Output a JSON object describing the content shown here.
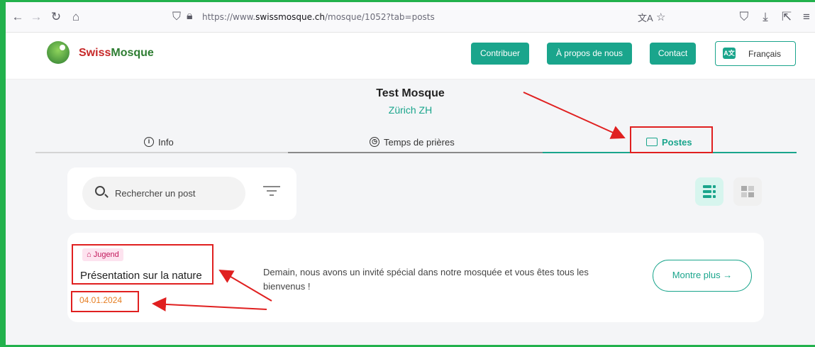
{
  "browser": {
    "url_prefix": "https://www.",
    "url_domain": "swissmosque.ch",
    "url_suffix": "/mosque/1052?tab=posts"
  },
  "header": {
    "brand_swiss": "Swiss",
    "brand_mosque": "Mosque",
    "buttons": {
      "contribute": "Contribuer",
      "about": "À propos de nous",
      "contact": "Contact"
    },
    "language": "Français"
  },
  "mosque": {
    "name": "Test Mosque",
    "city": "Zürich ZH"
  },
  "tabs": {
    "info": "Info",
    "prayer_times": "Temps de prières",
    "posts": "Postes"
  },
  "search": {
    "placeholder": "Rechercher un post"
  },
  "post": {
    "tag": "Jugend",
    "title": "Présentation sur la nature",
    "date": "04.01.2024",
    "description": "Demain, nous avons un invité spécial dans notre mosquée et vous êtes tous les bienvenus !",
    "more_label": "Montre plus"
  },
  "colors": {
    "accent": "#1aa58c",
    "annotation": "#e02020",
    "frame": "#22b14c",
    "date": "#e67e22"
  }
}
